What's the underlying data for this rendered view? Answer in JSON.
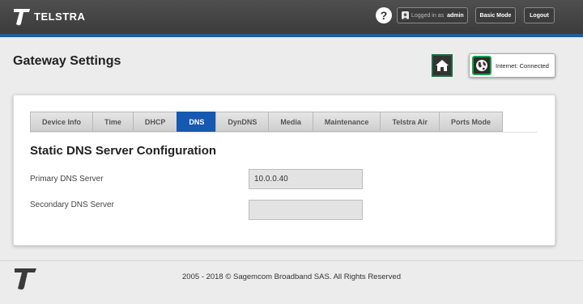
{
  "header": {
    "brand": "TELSTRA",
    "help_label": "?",
    "logged_in_prefix": "Logged in as",
    "username": "admin",
    "basic_mode_label": "Basic Mode",
    "logout_label": "Logout"
  },
  "page": {
    "title": "Gateway Settings",
    "internet_status": "Internet: Connected"
  },
  "tabs": [
    {
      "label": "Device Info",
      "active": false
    },
    {
      "label": "Time",
      "active": false
    },
    {
      "label": "DHCP",
      "active": false
    },
    {
      "label": "DNS",
      "active": true
    },
    {
      "label": "DynDNS",
      "active": false
    },
    {
      "label": "Media",
      "active": false
    },
    {
      "label": "Maintenance",
      "active": false
    },
    {
      "label": "Telstra Air",
      "active": false
    },
    {
      "label": "Ports Mode",
      "active": false
    }
  ],
  "form": {
    "title": "Static DNS Server Configuration",
    "primary_label": "Primary DNS Server",
    "primary_value": "10.0.0.40",
    "secondary_label": "Secondary DNS Server",
    "secondary_value": ""
  },
  "footer": {
    "copyright": "2005 - 2018 © Sagemcom Broadband SAS. All Rights Reserved"
  },
  "colors": {
    "header_bg": "#444444",
    "accent_blue": "#1659b0",
    "connected_green": "#1e9e48"
  },
  "icons": {
    "logo": "telstra-t-logo",
    "help": "question-icon",
    "user": "user-icon",
    "home": "home-icon",
    "internet": "globe-icon"
  }
}
